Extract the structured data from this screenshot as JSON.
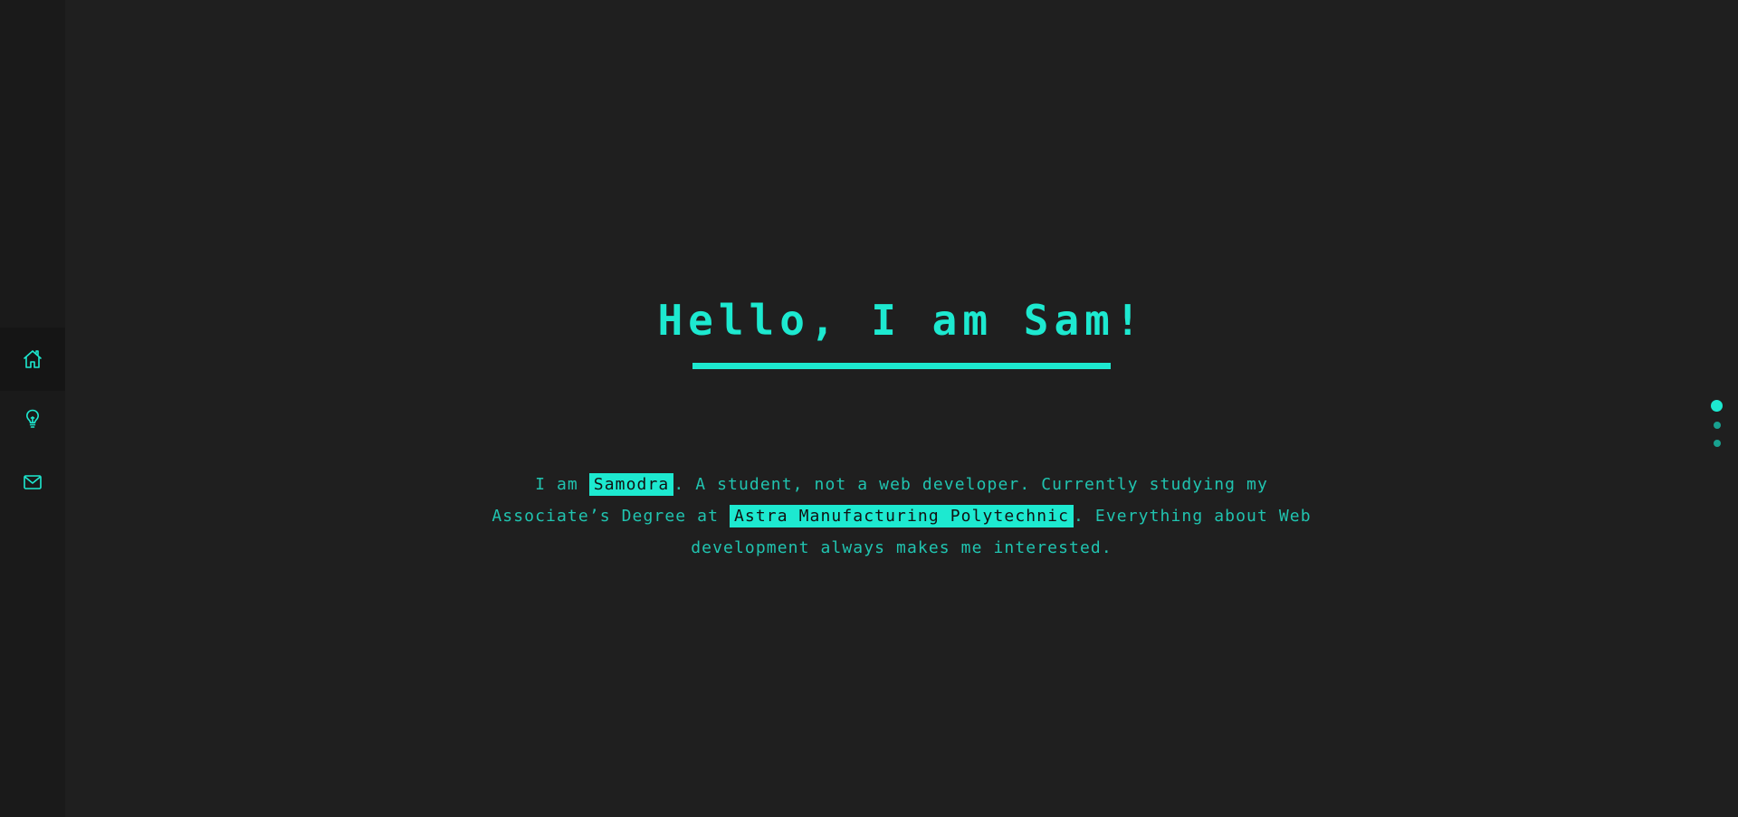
{
  "sidebar": {
    "items": [
      {
        "icon": "home-icon",
        "label": "Home",
        "active": true
      },
      {
        "icon": "lightbulb-icon",
        "label": "Ideas",
        "active": false
      },
      {
        "icon": "mail-icon",
        "label": "Contact",
        "active": false
      }
    ]
  },
  "hero": {
    "title": "Hello, I am Sam!",
    "intro": {
      "part1": "I am ",
      "name": "Samodra",
      "part2": ". A student, not a web developer. Currently studying my Associate’s Degree at ",
      "school": "Astra Manufacturing Polytechnic",
      "part3": ". Everything about Web development always makes me interested."
    }
  },
  "section_dots": {
    "count": 3,
    "active_index": 0
  },
  "colors": {
    "background": "#1f1f1f",
    "sidebar": "#1a1a1a",
    "accent": "#1de9d0",
    "text": "#20c4b0"
  }
}
